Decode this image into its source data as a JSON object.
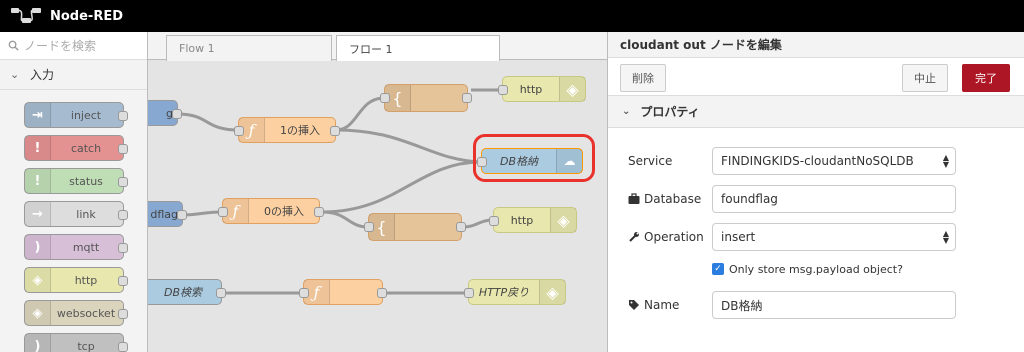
{
  "app": {
    "title": "Node-RED"
  },
  "palette": {
    "search_placeholder": "ノードを検索",
    "category": "入力",
    "nodes": [
      {
        "label": "inject",
        "color": "#a6bbcf"
      },
      {
        "label": "catch",
        "color": "#e49191"
      },
      {
        "label": "status",
        "color": "#c0deb6"
      },
      {
        "label": "link",
        "color": "#dddddd"
      },
      {
        "label": "mqtt",
        "color": "#d8bfd8"
      },
      {
        "label": "http",
        "color": "#e7e7ae"
      },
      {
        "label": "websocket",
        "color": "#dbd4bc"
      },
      {
        "label": "tcp",
        "color": "#c0c0c0"
      }
    ]
  },
  "workspace": {
    "tabs": [
      {
        "label": "Flow 1"
      },
      {
        "label": "フロー 1"
      }
    ],
    "nodes": {
      "flag_partial": "g",
      "insert1": "1の挿入",
      "http_top": "http",
      "db_store": "DB格納",
      "foundflag_partial": "dflag",
      "insert0": "0の挿入",
      "http_mid": "http",
      "db_search": "DB検索",
      "http_resp": "HTTP戻り"
    },
    "highlight_color": "#e8322b"
  },
  "editor": {
    "title": "cloudant out ノードを編集",
    "delete_label": "削除",
    "cancel_label": "中止",
    "done_label": "完了",
    "section_label": "プロパティ",
    "service": {
      "label": "Service",
      "value": "FINDINGKIDS-cloudantNoSQLDB"
    },
    "database": {
      "label": "Database",
      "value": "foundflag"
    },
    "operation": {
      "label": "Operation",
      "value": "insert"
    },
    "only_store": {
      "label": "Only store msg.payload object?",
      "checked": true
    },
    "name": {
      "label": "Name",
      "value": "DB格納"
    },
    "accent_color": "#ad1625"
  }
}
